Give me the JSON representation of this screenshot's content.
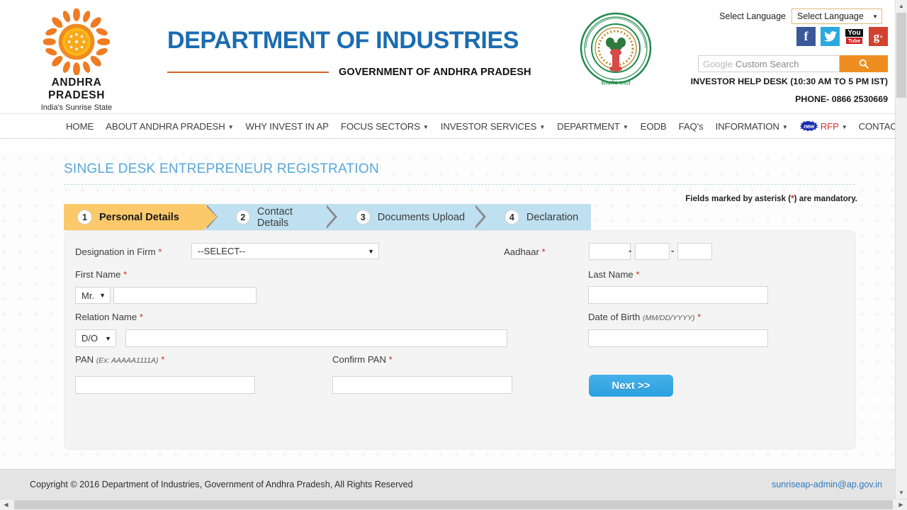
{
  "header": {
    "logo": {
      "name": "ANDHRA PRADESH",
      "tagline": "India's Sunrise State",
      "icon": "sun-logo-icon"
    },
    "department_title": "DEPARTMENT OF INDUSTRIES",
    "government_title": "GOVERNMENT OF ANDHRA PRADESH",
    "emblem_text": "GOVERNMENT OF ANDHRA PRADESH",
    "emblem_motto": "सत्यमेव जयते",
    "language": {
      "label": "Select Language",
      "selected": "Select Language",
      "caret": "▼"
    },
    "social": [
      {
        "name": "facebook-icon",
        "glyph": "f",
        "color": "#3b5998"
      },
      {
        "name": "twitter-icon",
        "glyph": "",
        "color": "#29a9e0"
      },
      {
        "name": "youtube-icon",
        "glyph": "You Tube",
        "color": "#cf1f1f"
      },
      {
        "name": "googleplus-icon",
        "glyph": "g",
        "color": "#d1422f"
      }
    ],
    "search": {
      "brand": "Google",
      "placeholder": "Custom Search",
      "value": "",
      "button_icon": "search-icon"
    },
    "help_desk": "INVESTOR HELP DESK (10:30 AM TO 5 PM IST)",
    "phone": "PHONE- 0866 2530669"
  },
  "nav": {
    "items": [
      {
        "label": "HOME",
        "caret": false
      },
      {
        "label": "ABOUT ANDHRA PRADESH",
        "caret": true
      },
      {
        "label": "WHY INVEST IN AP",
        "caret": false
      },
      {
        "label": "FOCUS SECTORS",
        "caret": true
      },
      {
        "label": "INVESTOR SERVICES",
        "caret": true
      },
      {
        "label": "DEPARTMENT",
        "caret": true
      },
      {
        "label": "EODB",
        "caret": false
      },
      {
        "label": "FAQ's",
        "caret": false
      },
      {
        "label": "INFORMATION",
        "caret": true
      },
      {
        "label": "RFP",
        "caret": true,
        "badge": "new"
      },
      {
        "label": "CONTACT",
        "caret": true
      }
    ],
    "caret_glyph": "▼"
  },
  "main": {
    "page_title": "SINGLE DESK ENTREPRENEUR REGISTRATION",
    "mandatory_note_pre": "Fields marked by asterisk (",
    "mandatory_note_ast": "*",
    "mandatory_note_post": ") are mandatory.",
    "steps": [
      {
        "num": "1",
        "label": "Personal Details",
        "active": true
      },
      {
        "num": "2",
        "label": "Contact Details",
        "active": false
      },
      {
        "num": "3",
        "label": "Documents Upload",
        "active": false
      },
      {
        "num": "4",
        "label": "Declaration",
        "active": false
      }
    ],
    "form": {
      "designation": {
        "label": "Designation in Firm",
        "required": "*",
        "selected": "--SELECT--",
        "caret": "▼"
      },
      "aadhaar": {
        "label": "Aadhaar",
        "required": "*",
        "part1": "",
        "part2": "",
        "part3": "",
        "separator": "-"
      },
      "first_name": {
        "label": "First Name",
        "required": "*",
        "salutation": "Mr.",
        "caret": "▼",
        "value": ""
      },
      "last_name": {
        "label": "Last Name",
        "required": "*",
        "value": ""
      },
      "relation_name": {
        "label": "Relation Name",
        "required": "*",
        "relation": "D/O",
        "caret": "▼",
        "value": ""
      },
      "dob": {
        "label": "Date of Birth",
        "hint": "(MM/DD/YYYY)",
        "required": "*",
        "value": ""
      },
      "pan": {
        "label": "PAN",
        "hint": "(Ex: AAAAA1111A)",
        "required": "*",
        "value": ""
      },
      "confirm_pan": {
        "label": "Confirm PAN",
        "required": "*",
        "value": ""
      },
      "next_button": "Next >>"
    }
  },
  "footer": {
    "copyright": "Copyright © 2016 Department of Industries, Government of Andhra Pradesh, All Rights Reserved",
    "admin_email": "sunriseap-admin@ap.gov.in"
  },
  "scrollbars": {
    "up_arrow": "▲",
    "down_arrow": "▼",
    "left_arrow": "◀",
    "right_arrow": "▶"
  },
  "colors": {
    "brand_blue": "#1b6cb0",
    "accent_orange": "#ef8e20",
    "title_blue": "#56a8d8",
    "step_active": "#fbc96a",
    "step_bar": "#bfe0f0",
    "required_red": "#cc2b1f",
    "next_blue": "#2aa1e0"
  }
}
